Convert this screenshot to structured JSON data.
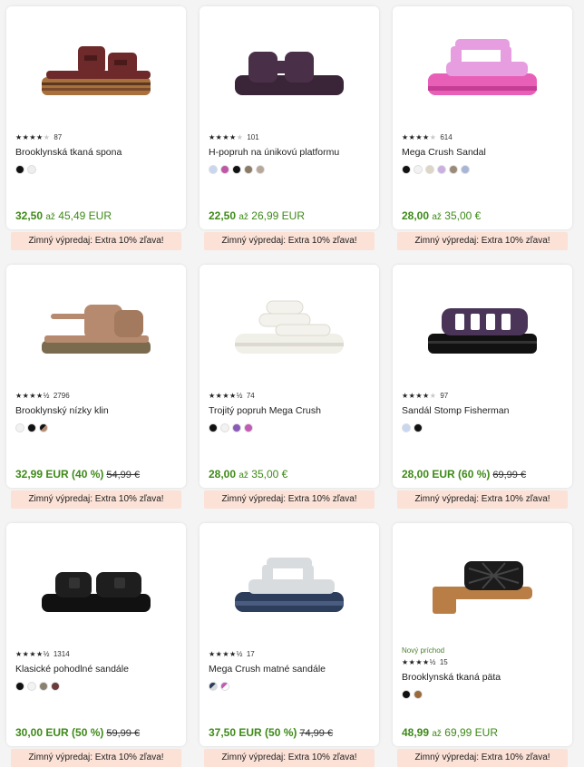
{
  "promo_label": "Zimný výpredaj: Extra 10% zľava!",
  "products": [
    {
      "name": "Brooklynská tkaná spona",
      "stars": 4,
      "reviews": "87",
      "new": "",
      "price_from": "32,50",
      "price_sep": "až",
      "price_to": "45,49 EUR",
      "price": "",
      "old": "",
      "swatches": [
        "#111111",
        "#eeeeee"
      ],
      "icon": "brown-platform-buckle-sandal-image"
    },
    {
      "name": "H-popruh na únikovú platformu",
      "stars": 4,
      "reviews": "101",
      "new": "",
      "price_from": "22,50",
      "price_sep": "až",
      "price_to": "26,99 EUR",
      "price": "",
      "old": "",
      "swatches": [
        "#c9d6f2",
        "#c056a6",
        "#111111",
        "#8a7a66",
        "#b7a89a"
      ],
      "icon": "purple-h-strap-platform-sandal-image"
    },
    {
      "name": "Mega Crush Sandal",
      "stars": 4,
      "reviews": "614",
      "new": "",
      "price_from": "28,00",
      "price_sep": "až",
      "price_to": "35,00 €",
      "price": "",
      "old": "",
      "swatches": [
        "#111111",
        "#f2f2f2",
        "#ddd5c5",
        "#c9b0e0",
        "#9a8a78",
        "#a7b5d6"
      ],
      "icon": "pink-mega-crush-sandal-image"
    },
    {
      "name": "Brooklynský nízky klin",
      "stars": 4.5,
      "reviews": "2796",
      "new": "",
      "price_from": "",
      "price_sep": "",
      "price_to": "",
      "price": "32,99 EUR (40 %)",
      "old": "54,99 €",
      "swatches": [
        "#f2f2f2",
        "#111111",
        "#6b6b4f"
      ],
      "icon": "tan-low-wedge-sandal-image"
    },
    {
      "name": "Trojitý popruh Mega Crush",
      "stars": 4.5,
      "reviews": "74",
      "new": "",
      "price_from": "28,00",
      "price_sep": "až",
      "price_to": "35,00 €",
      "price": "",
      "old": "",
      "swatches": [
        "#111111",
        "#f2f2f2",
        "#8a5ab8",
        "#c25bb5"
      ],
      "icon": "white-triple-strap-mega-crush-image"
    },
    {
      "name": "Sandál Stomp Fisherman",
      "stars": 4,
      "reviews": "97",
      "new": "",
      "price_from": "",
      "price_sep": "",
      "price_to": "",
      "price": "28,00 EUR (60 %)",
      "old": "69,99 €",
      "swatches": [
        "#c9d6f2",
        "#111111"
      ],
      "icon": "purple-fisherman-sandal-image"
    },
    {
      "name": "Klasické pohodlné sandále",
      "stars": 4.5,
      "reviews": "1314",
      "new": "",
      "price_from": "",
      "price_sep": "",
      "price_to": "",
      "price": "30,00 EUR (50 %)",
      "old": "59,99 €",
      "swatches": [
        "#111111",
        "#f2f2f2",
        "#8a8070",
        "#6b3a3a"
      ],
      "icon": "black-cozzzy-sandal-image"
    },
    {
      "name": "Mega Crush matné sandále",
      "stars": 4.5,
      "reviews": "17",
      "new": "",
      "price_from": "",
      "price_sep": "",
      "price_to": "",
      "price": "37,50 EUR (50 %)",
      "old": "74,99 €",
      "swatches": [
        "#2c3e5c",
        "#c25bb5"
      ],
      "icon": "grey-blue-mega-crush-matte-image"
    },
    {
      "name": "Brooklynská tkaná päta",
      "stars": 4.5,
      "reviews": "15",
      "new": "Nový príchod",
      "price_from": "48,99",
      "price_sep": "až",
      "price_to": "69,99 EUR",
      "price": "",
      "old": "",
      "swatches": [
        "#111111",
        "#9a6a3a"
      ],
      "icon": "black-woven-heel-sandal-image"
    }
  ]
}
